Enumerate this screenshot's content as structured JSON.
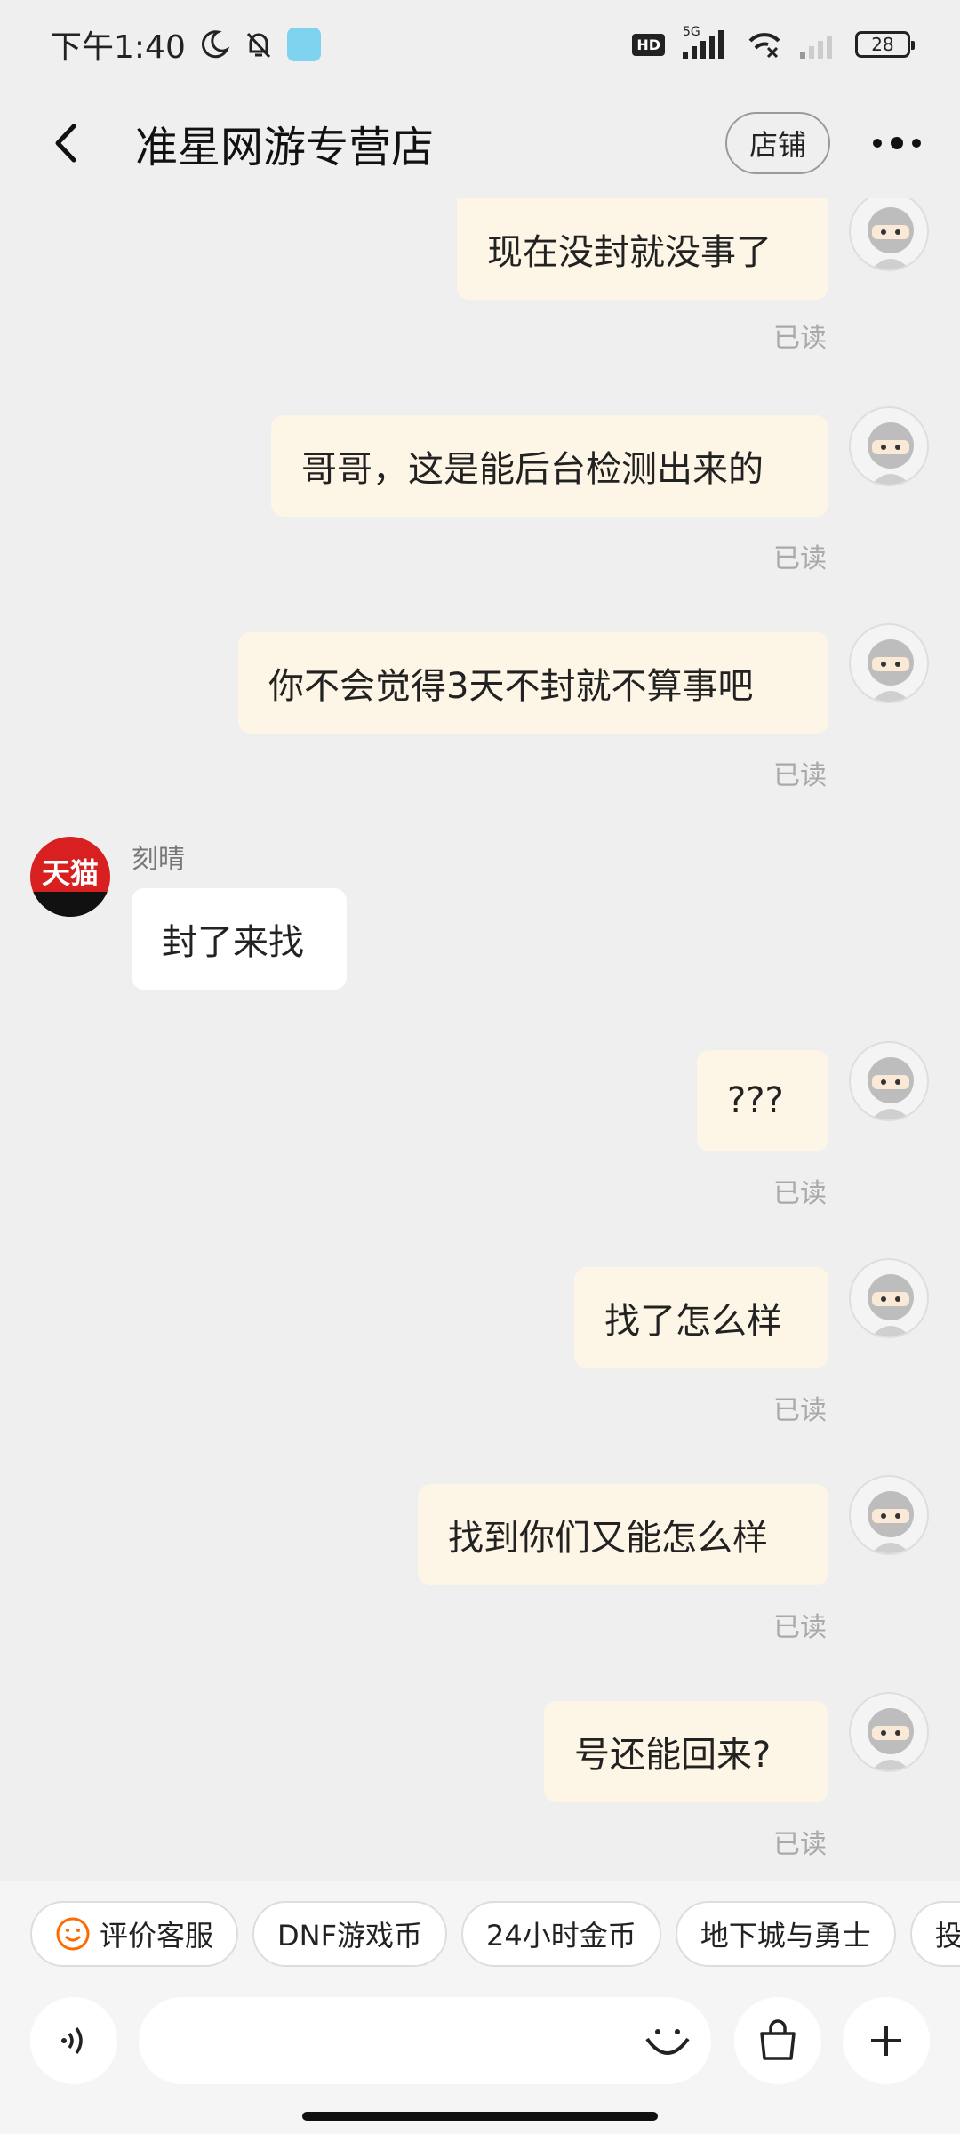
{
  "status_bar": {
    "time": "下午1:40",
    "hd": "HD",
    "network": "5G",
    "battery": "28"
  },
  "header": {
    "title": "准星网游专营店",
    "shop_button": "店铺"
  },
  "messages": [
    {
      "side": "mine",
      "text": "现在没封就没事了",
      "read": "已读"
    },
    {
      "side": "mine",
      "text": "哥哥，这是能后台检测出来的",
      "read": "已读"
    },
    {
      "side": "mine",
      "text": "你不会觉得3天不封就不算事吧",
      "read": "已读"
    },
    {
      "side": "theirs",
      "sender": "刻晴",
      "avatar_text": "天猫",
      "text": "封了来找"
    },
    {
      "side": "mine",
      "text": "???",
      "read": "已读"
    },
    {
      "side": "mine",
      "text": "找了怎么样",
      "read": "已读"
    },
    {
      "side": "mine",
      "text": "找到你们又能怎么样",
      "read": "已读"
    },
    {
      "side": "mine",
      "text": "号还能回来?",
      "read": "已读"
    }
  ],
  "quick_chips": [
    {
      "label": "评价客服",
      "icon": "smile-icon"
    },
    {
      "label": "DNF游戏币"
    },
    {
      "label": "24小时金币"
    },
    {
      "label": "地下城与勇士"
    },
    {
      "label": "投诉"
    }
  ],
  "input": {
    "placeholder": "",
    "value": ""
  },
  "colors": {
    "mine_bubble": "#fdf6e6",
    "theirs_bubble": "#ffffff",
    "background": "#efefef",
    "tmall_red": "#d92020",
    "smile_orange": "#ff6a00"
  }
}
